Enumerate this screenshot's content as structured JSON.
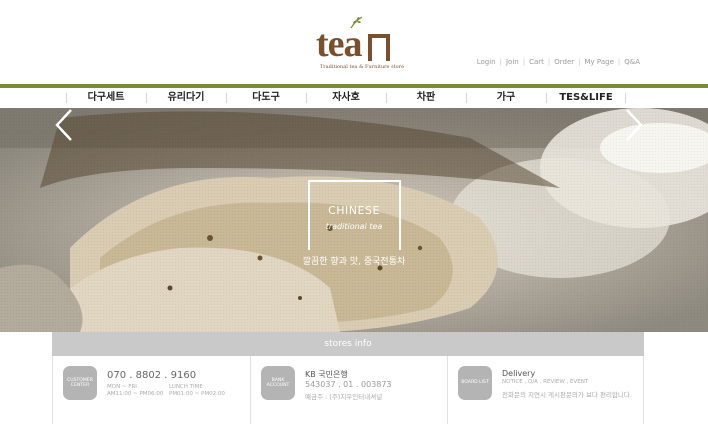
{
  "brand": {
    "logo_text": "tea",
    "tagline": "Traditional tea & Furniture store",
    "color": "#7a4f2c"
  },
  "utility_links": [
    "Login",
    "Join",
    "Cart",
    "Order",
    "My Page",
    "Q&A"
  ],
  "nav": {
    "items": [
      "다구세트",
      "유리다기",
      "다도구",
      "자사호",
      "차판",
      "가구",
      "TES&LIFE"
    ],
    "accent": "#7b8a36"
  },
  "hero": {
    "title": "CHINESE",
    "subtitle": "traditional tea",
    "caption": "깔끔한 향과 맛, 중국전통차",
    "prev_icon": "chevron-left-icon",
    "next_icon": "chevron-right-icon"
  },
  "stores_info": {
    "heading": "stores info",
    "customer": {
      "badge": "CUSTOMER CENTER",
      "phone": "070 . 8802 . 9160",
      "hours_left": "MON ~ FRI",
      "hours_left2": "AM11:00 ~ PM06:00",
      "hours_right": "LUNCH TIME",
      "hours_right2": "PM01:00 ~ PM02:00"
    },
    "bank": {
      "badge": "BANK ACCOUNT",
      "name": "KB 국민은행",
      "account": "543037 . 01 . 003873",
      "owner": "예금주 : (주)지우인터내셔널"
    },
    "board": {
      "badge": "BOARD LIST",
      "title": "Delivery",
      "sub": "NOTICE , Q/A , REVIEW , EVENT",
      "desc": "전화문의 지연시 게시판문의가 보다 편리합니다."
    }
  }
}
